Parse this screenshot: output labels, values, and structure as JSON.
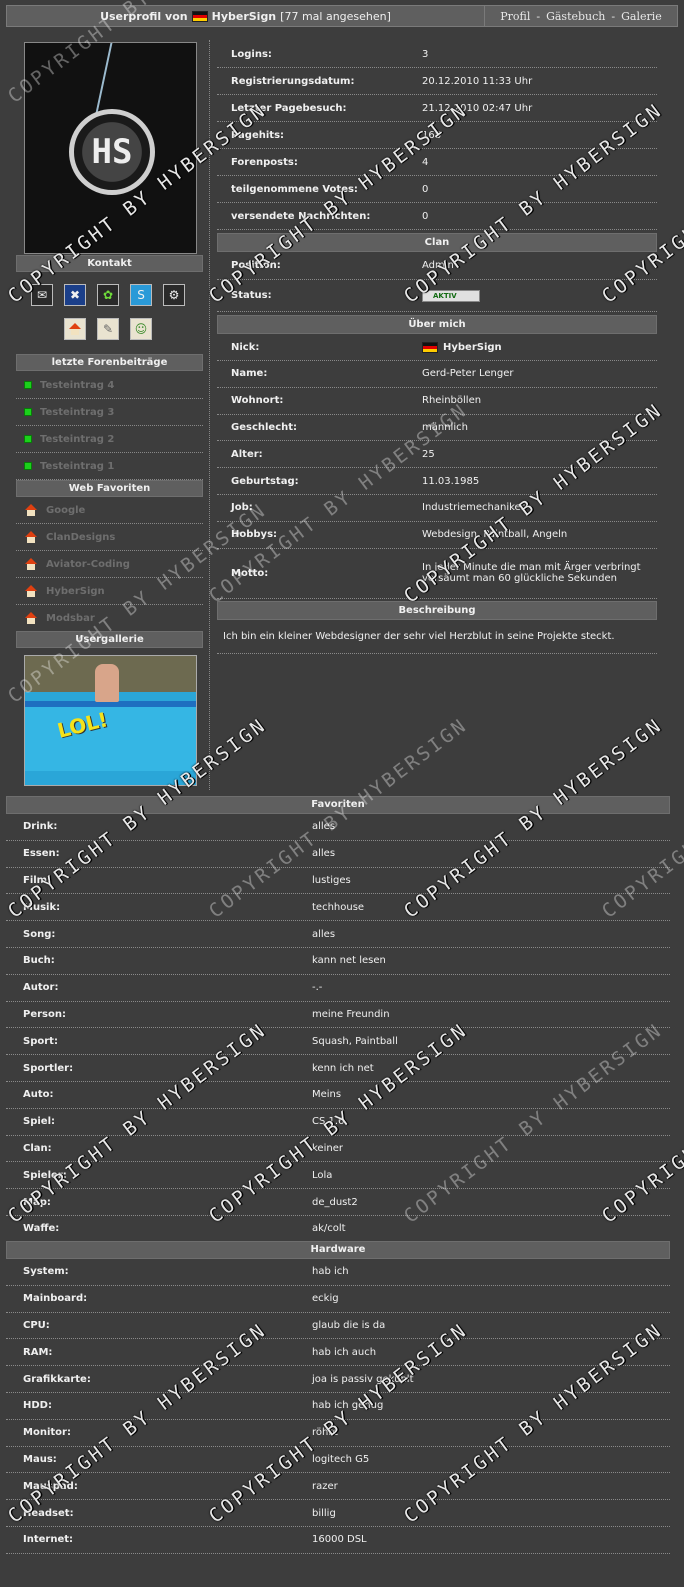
{
  "header": {
    "title_prefix": "Userprofil von",
    "username": "HyberSign",
    "views": "[77 mal angesehen]",
    "nav": [
      "Profil",
      "-",
      "Gästebuch",
      "-",
      "Galerie"
    ]
  },
  "left": {
    "kontakt_label": "Kontakt",
    "contact_icons": [
      "mail-icon",
      "xfire-icon",
      "icq-icon",
      "skype-icon",
      "steam-icon"
    ],
    "contact_icons2": [
      "homepage-icon",
      "card-icon",
      "add-buddy-icon"
    ],
    "forum_label": "letzte Forenbeiträge",
    "forum_posts": [
      "Testeintrag 4",
      "Testeintrag 3",
      "Testeintrag 2",
      "Testeintrag 1"
    ],
    "web_label": "Web Favoriten",
    "web_links": [
      "Google",
      "ClanDesigns",
      "Aviator-Coding",
      "HyberSign",
      "Modsbar"
    ],
    "gallery_label": "Usergallerie",
    "gallery_text": "LOL!"
  },
  "stats": [
    {
      "k": "Logins:",
      "v": "3"
    },
    {
      "k": "Registrierungsdatum:",
      "v": "20.12.2010 11:33 Uhr"
    },
    {
      "k": "Letzter Pagebesuch:",
      "v": "21.12.2010 02:47 Uhr"
    },
    {
      "k": "Pagehits:",
      "v": "168"
    },
    {
      "k": "Forenposts:",
      "v": "4"
    },
    {
      "k": "teilgenommene Votes:",
      "v": "0"
    },
    {
      "k": "versendete Nachrichten:",
      "v": "0"
    }
  ],
  "clan": {
    "label": "Clan",
    "position_k": "Position:",
    "position_v": "Admin",
    "status_k": "Status:",
    "status_v": "AKTIV"
  },
  "about": {
    "label": "Über mich",
    "nick_k": "Nick:",
    "nick_v": "HyberSign",
    "rows": [
      {
        "k": "Name:",
        "v": "Gerd-Peter Lenger"
      },
      {
        "k": "Wohnort:",
        "v": "Rheinböllen"
      },
      {
        "k": "Geschlecht:",
        "v": "männlich"
      },
      {
        "k": "Alter:",
        "v": "25"
      },
      {
        "k": "Geburtstag:",
        "v": "11.03.1985"
      },
      {
        "k": "Job:",
        "v": "Industriemechaniker"
      },
      {
        "k": "Hobbys:",
        "v": "Webdesign, Paintball, Angeln"
      }
    ],
    "motto_k": "Motto:",
    "motto_v": "In jeder Minute die man mit Ärger verbringt versäumt man 60 glückliche Sekunden"
  },
  "beschreibung": {
    "label": "Beschreibung",
    "text": "Ich bin ein kleiner Webdesigner der sehr viel Herzblut in seine Projekte steckt."
  },
  "favoriten": {
    "label": "Favoriten",
    "rows": [
      {
        "k": "Drink:",
        "v": "alles"
      },
      {
        "k": "Essen:",
        "v": "alles"
      },
      {
        "k": "Film:",
        "v": "lustiges"
      },
      {
        "k": "Musik:",
        "v": "techhouse"
      },
      {
        "k": "Song:",
        "v": "alles"
      },
      {
        "k": "Buch:",
        "v": "kann net lesen"
      },
      {
        "k": "Autor:",
        "v": "-.-"
      },
      {
        "k": "Person:",
        "v": "meine Freundin"
      },
      {
        "k": "Sport:",
        "v": "Squash, Paintball"
      },
      {
        "k": "Sportler:",
        "v": "kenn ich net"
      },
      {
        "k": "Auto:",
        "v": "Meins"
      },
      {
        "k": "Spiel:",
        "v": "CS 1.6"
      },
      {
        "k": "Clan:",
        "v": "keiner"
      },
      {
        "k": "Spieler:",
        "v": "Lola"
      },
      {
        "k": "Map:",
        "v": "de_dust2"
      },
      {
        "k": "Waffe:",
        "v": "ak/colt"
      }
    ]
  },
  "hardware": {
    "label": "Hardware",
    "rows": [
      {
        "k": "System:",
        "v": "hab ich"
      },
      {
        "k": "Mainboard:",
        "v": "eckig"
      },
      {
        "k": "CPU:",
        "v": "glaub die is da"
      },
      {
        "k": "RAM:",
        "v": "hab ich auch"
      },
      {
        "k": "Grafikkarte:",
        "v": "joa is passiv gekühlt"
      },
      {
        "k": "HDD:",
        "v": "hab ich genug"
      },
      {
        "k": "Monitor:",
        "v": "röhre"
      },
      {
        "k": "Maus:",
        "v": "logitech G5"
      },
      {
        "k": "Mauspad:",
        "v": "razer"
      },
      {
        "k": "Headset:",
        "v": "billig"
      },
      {
        "k": "Internet:",
        "v": "16000 DSL"
      }
    ]
  },
  "watermark": "COPYRIGHT BY HYBERSIGN"
}
